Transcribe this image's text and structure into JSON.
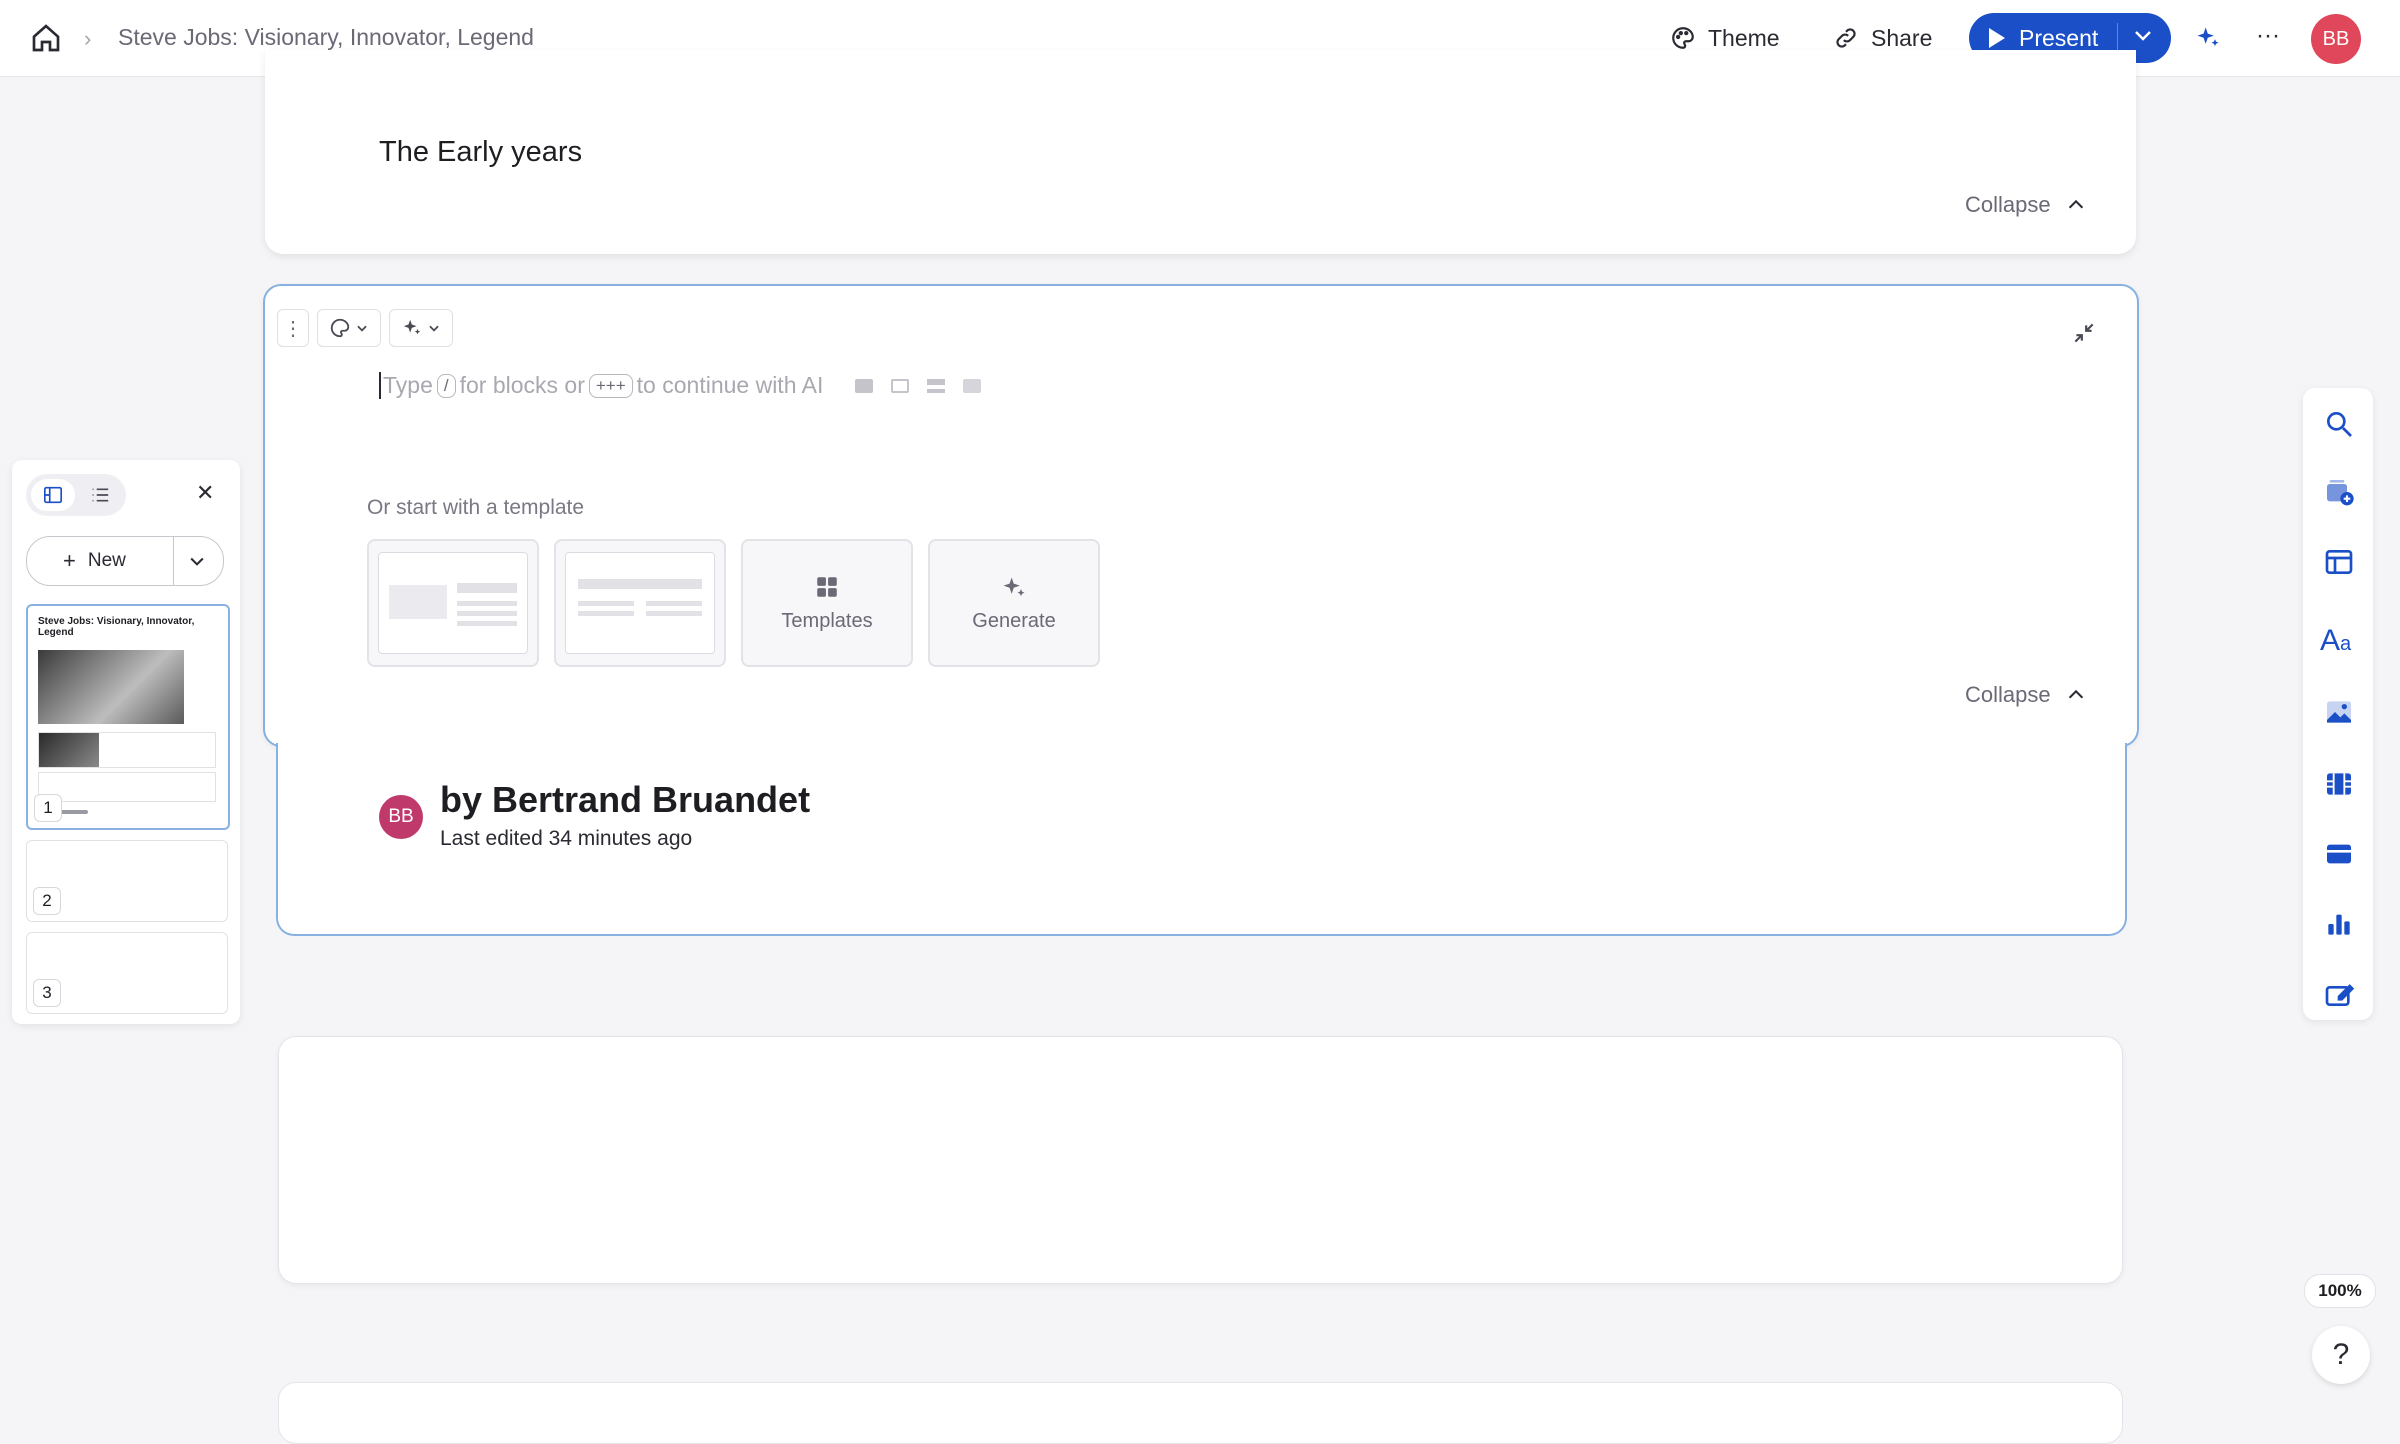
{
  "header": {
    "breadcrumb_title": "Steve Jobs: Visionary, Innovator, Legend",
    "theme_label": "Theme",
    "share_label": "Share",
    "present_label": "Present",
    "avatar_initials": "BB"
  },
  "cards": {
    "early_years_heading": "The Early years",
    "collapse_label": "Collapse",
    "editor": {
      "placeholder_pre": "Type",
      "slash_key": "/",
      "placeholder_mid": "for blocks or",
      "plus_key": "+++",
      "placeholder_post": "to continue with AI",
      "template_prompt": "Or start with a template",
      "templates_label": "Templates",
      "generate_label": "Generate"
    },
    "author": {
      "initials": "BB",
      "byline": "by Bertrand Bruandet",
      "edited": "Last edited 34 minutes ago"
    }
  },
  "sidebar": {
    "new_label": "New",
    "thumbnail_title": "Steve Jobs: Visionary, Innovator, Legend",
    "slides": [
      "1",
      "2",
      "3"
    ]
  },
  "zoom": "100%",
  "help": "?",
  "colors": {
    "accent": "#1b4fc7",
    "card_outline": "#86b1e0",
    "avatar": "#e0475b",
    "author_avatar": "#c0396b"
  }
}
